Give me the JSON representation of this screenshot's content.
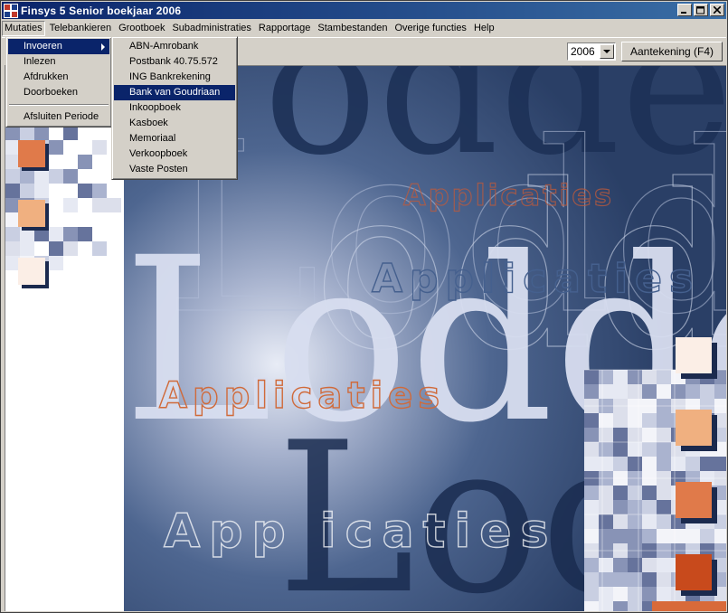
{
  "window": {
    "title": "Finsys 5 Senior boekjaar 2006",
    "app_icon": "finsys-app-icon",
    "buttons": [
      "minimize-icon",
      "maximize-icon",
      "close-icon"
    ]
  },
  "menubar": {
    "items": [
      "Mutaties",
      "Telebankieren",
      "Grootboek",
      "Subadministraties",
      "Rapportage",
      "Stambestanden",
      "Overige functies",
      "Help"
    ]
  },
  "mutaties_menu": {
    "items": [
      "Invoeren",
      "Inlezen",
      "Afdrukken",
      "Doorboeken",
      "Afsluiten Periode"
    ]
  },
  "invoeren_submenu": {
    "items": [
      "ABN-Amrobank",
      "Postbank 40.75.572",
      "ING Bankrekening",
      "Bank van Goudriaan",
      "Inkoopboek",
      "Kasboek",
      "Memoriaal",
      "Verkoopboek",
      "Vaste Posten"
    ],
    "highlighted": "Bank van Goudriaan"
  },
  "toolbar": {
    "year": "2006",
    "note_button": "Aantekening (F4)"
  },
  "background": {
    "brand_text": "Lodder",
    "tagline": "Applicaties"
  },
  "colors": {
    "title_active": "#0a246a",
    "menu_highlight": "#0a246a",
    "background_navy": "#2b4268",
    "accent_orange": "#e07a4a",
    "accent_peach": "#f0b080",
    "accent_cream": "#fbeee6",
    "accent_rust": "#c84a1c"
  }
}
